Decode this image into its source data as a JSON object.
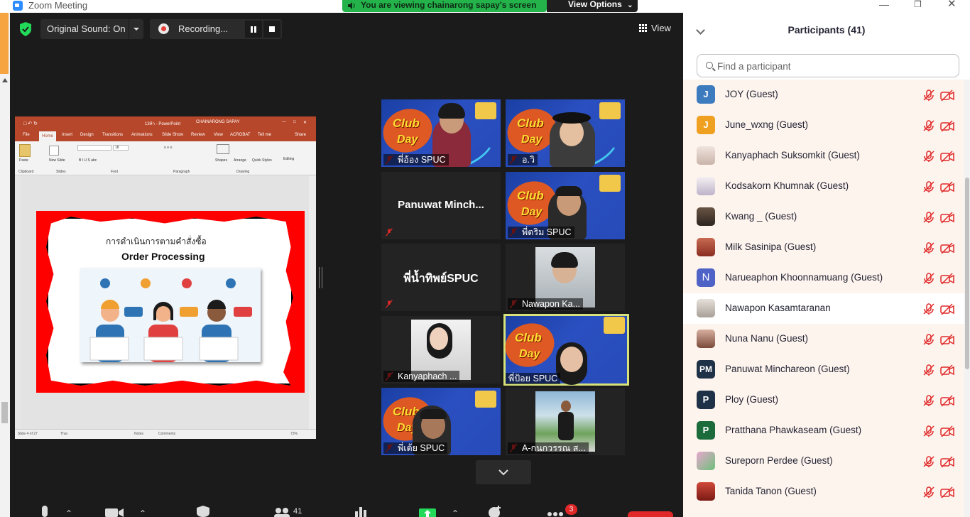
{
  "window": {
    "title": "Zoom Meeting"
  },
  "banner": {
    "viewing_text": "You are viewing chainarong sapay's screen",
    "view_options": "View Options"
  },
  "toolbar_top": {
    "original_sound": "Original Sound: On",
    "recording": "Recording...",
    "view": "View"
  },
  "ppt": {
    "window_title": "13ห้า - PowerPoint",
    "user": "CHAINARONG SAPAY",
    "tabs": [
      "File",
      "Home",
      "Insert",
      "Design",
      "Transitions",
      "Animations",
      "Slide Show",
      "Review",
      "View",
      "ACROBAT",
      "Tell me",
      "Share"
    ],
    "groups": [
      "Clipboard",
      "Slides",
      "Font",
      "Paragraph",
      "Drawing",
      "Editing"
    ],
    "ribbon_labels": {
      "paste": "Paste",
      "new_slide": "New Slide",
      "shapes": "Shapes",
      "arrange": "Arrange",
      "quick_styles": "Quick Styles",
      "editing": "Editing",
      "font_size": "18"
    },
    "slide_title_thai": "การดำเนินการตามคำสั่งซื้อ",
    "slide_title_en": "Order Processing",
    "status": {
      "slide": "Slide 4 of 27",
      "lang": "Thai",
      "notes": "Notes",
      "comments": "Comments",
      "zoom": "73%"
    }
  },
  "gallery": [
    {
      "name": "พี่อ้อง SPUC",
      "kind": "club"
    },
    {
      "name": "อ.วิ",
      "kind": "club"
    },
    {
      "name": "",
      "kind": "name",
      "big": "Panuwat  Minch..."
    },
    {
      "name": "พี่ตริม SPUC",
      "kind": "club"
    },
    {
      "name": "",
      "kind": "name",
      "big": "พี่น้ำทิพย์SPUC"
    },
    {
      "name": "Nawapon Ka...",
      "kind": "photo"
    },
    {
      "name": "Kanyaphach ...",
      "kind": "photo"
    },
    {
      "name": "พี่ป้อย SPUC",
      "kind": "club",
      "active": true
    },
    {
      "name": "พี่เต้ย SPUC",
      "kind": "club"
    },
    {
      "name": "A-กนกวรรณ ส...",
      "kind": "photo"
    }
  ],
  "bottom_bar": {
    "participants_count": "41",
    "chat_badge": "3"
  },
  "participants_panel": {
    "title": "Participants (41)",
    "search_placeholder": "Find a participant",
    "participants": [
      {
        "name": "JOY (Guest)",
        "initials": "J",
        "color": "#3d7bbf"
      },
      {
        "name": "June_wxng (Guest)",
        "initials": "J",
        "color": "#f0a020"
      },
      {
        "name": "Kanyaphach Suksomkit (Guest)",
        "initials": "",
        "color": "#e9d7cf"
      },
      {
        "name": "Kodsakorn Khumnak (Guest)",
        "initials": "",
        "color": "#e8e0e6"
      },
      {
        "name": "Kwang _ (Guest)",
        "initials": "",
        "color": "#4a3a2e"
      },
      {
        "name": "Milk Sasinipa (Guest)",
        "initials": "",
        "color": "#b04a3a"
      },
      {
        "name": "Narueaphon Khoonnamuang (Guest)",
        "initials": "N",
        "color": "#4f62c6"
      },
      {
        "name": "Nawapon Kasamtaranan",
        "initials": "",
        "color": "#d7cfc6"
      },
      {
        "name": "Nuna Nanu (Guest)",
        "initials": "",
        "color": "#b98a7a"
      },
      {
        "name": "Panuwat Minchareon (Guest)",
        "initials": "PM",
        "color": "#1f3146"
      },
      {
        "name": "Ploy (Guest)",
        "initials": "P",
        "color": "#1f3146"
      },
      {
        "name": "Pratthana Phawkaseam (Guest)",
        "initials": "P",
        "color": "#1c6b3a"
      },
      {
        "name": "Sureporn Perdee (Guest)",
        "initials": "",
        "color": "#c27aa8"
      },
      {
        "name": "Tanida Tanon (Guest)",
        "initials": "",
        "color": "#a4302a"
      }
    ]
  }
}
